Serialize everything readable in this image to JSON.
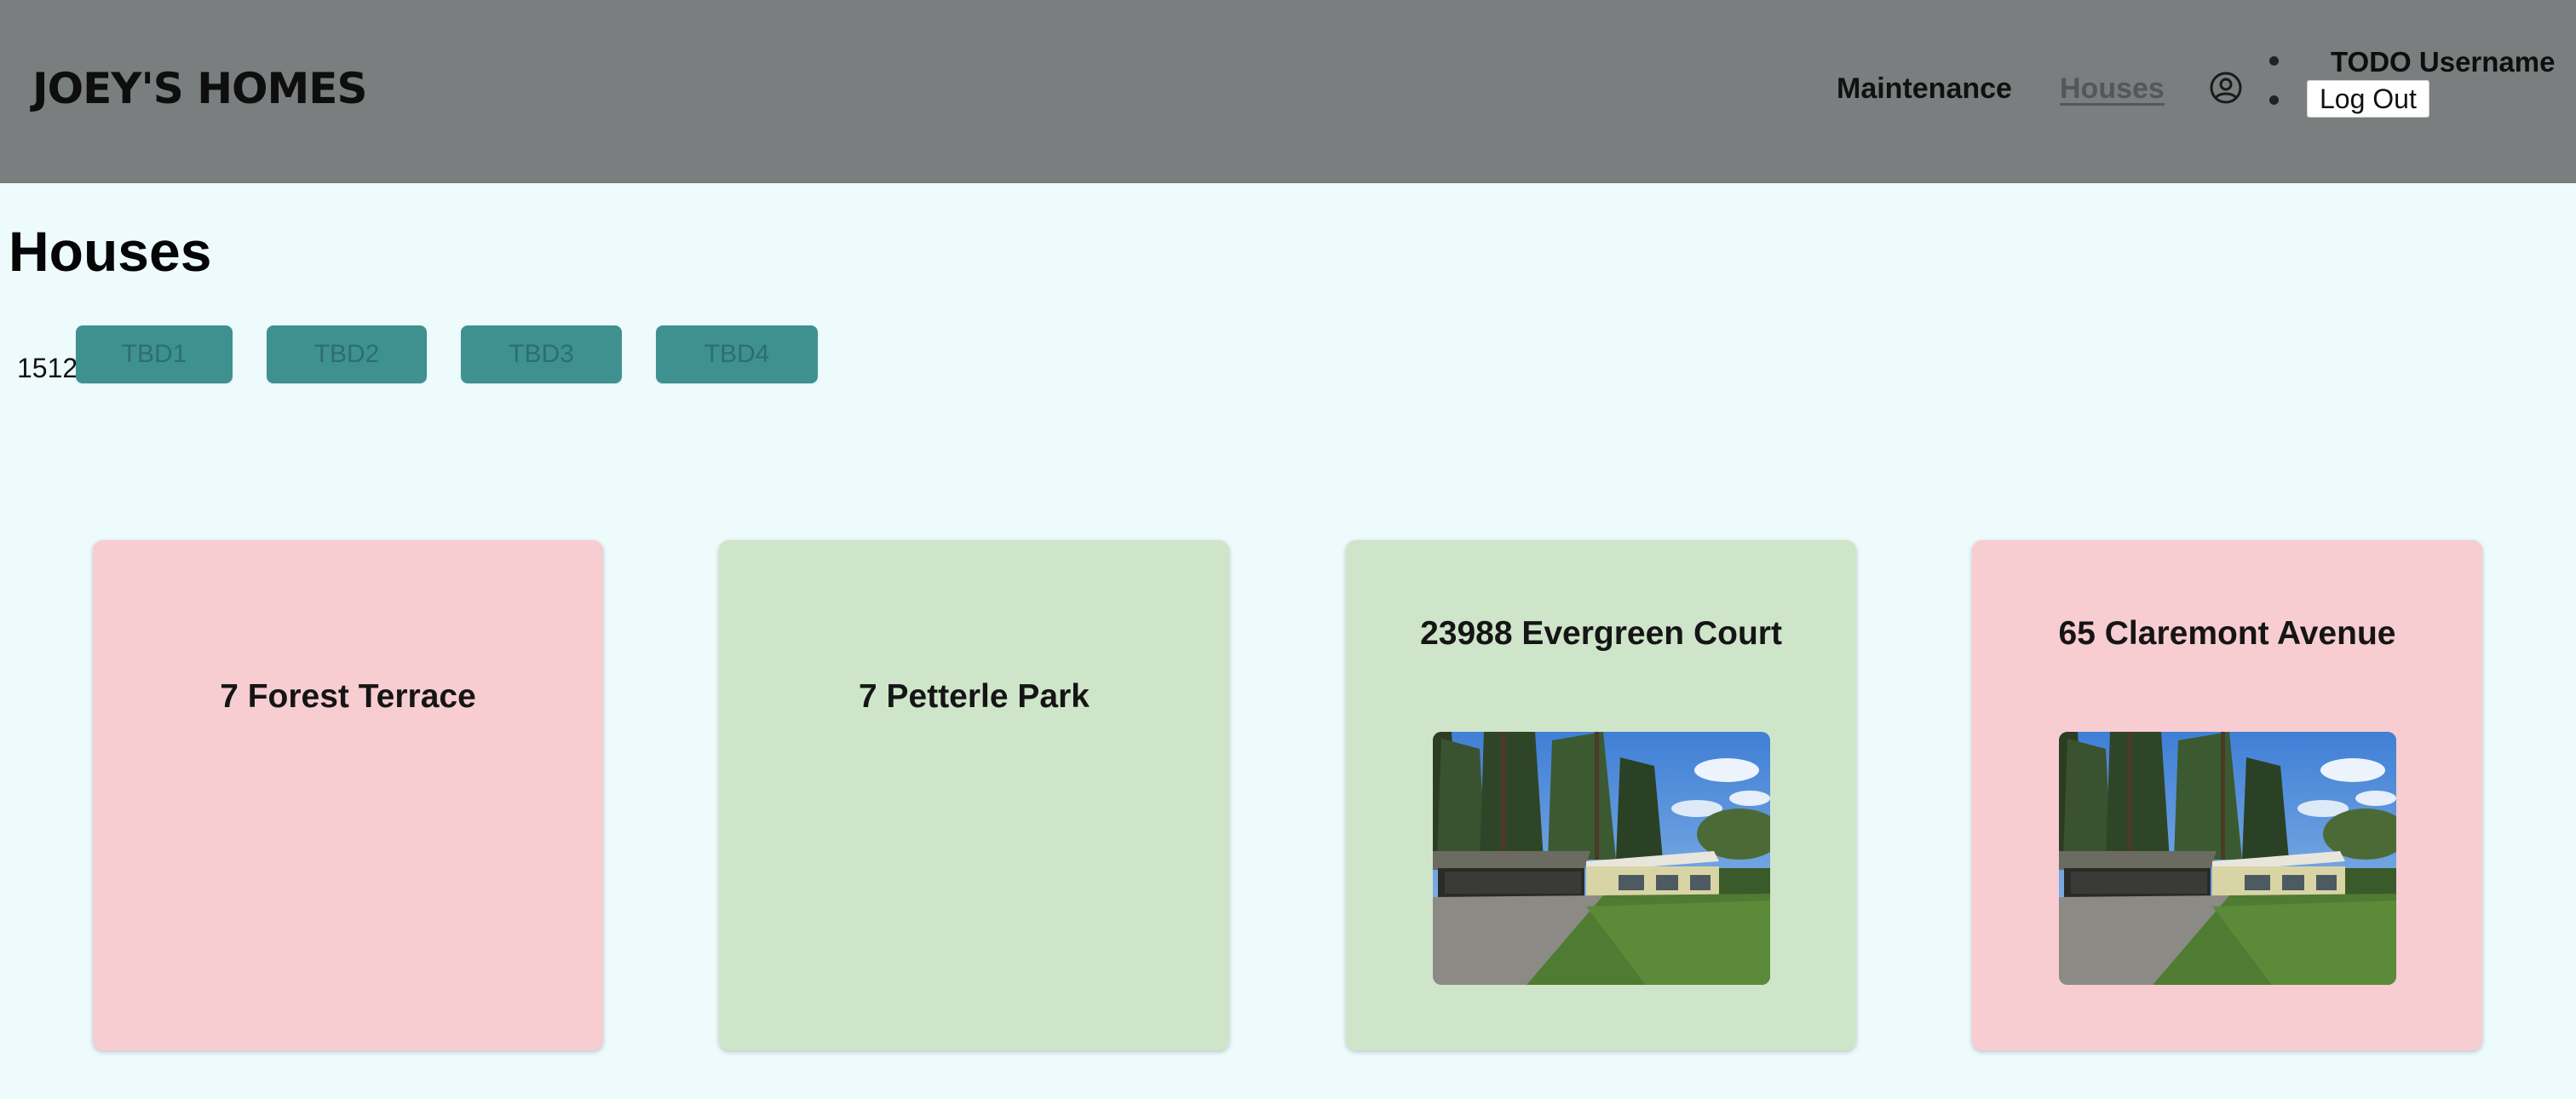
{
  "header": {
    "brand": "JOEY'S HOMES",
    "nav": [
      {
        "label": "Maintenance"
      },
      {
        "label": "Houses"
      }
    ],
    "user": {
      "username": "TODO Username",
      "logout_label": "Log Out"
    }
  },
  "main": {
    "title": "Houses",
    "count": "1512",
    "buttons": [
      "TBD1",
      "TBD2",
      "TBD3",
      "TBD4"
    ],
    "cards": [
      {
        "title": "7 Forest Terrace",
        "status_color": "#f7cdd2",
        "has_photo": false
      },
      {
        "title": "7 Petterle Park",
        "status_color": "#cfe5ca",
        "has_photo": false
      },
      {
        "title": "23988 Evergreen Court",
        "status_color": "#cfe5ca",
        "has_photo": true
      },
      {
        "title": "65 Claremont Avenue",
        "status_color": "#f7cdd2",
        "has_photo": true
      }
    ]
  },
  "colors": {
    "header_bg": "#7a7e7f",
    "page_bg": "#eefbfd",
    "button_bg": "#3f9190",
    "card_pink": "#f7cdd2",
    "card_green": "#cfe5ca"
  },
  "icons": {
    "user": "user-circle-icon"
  }
}
